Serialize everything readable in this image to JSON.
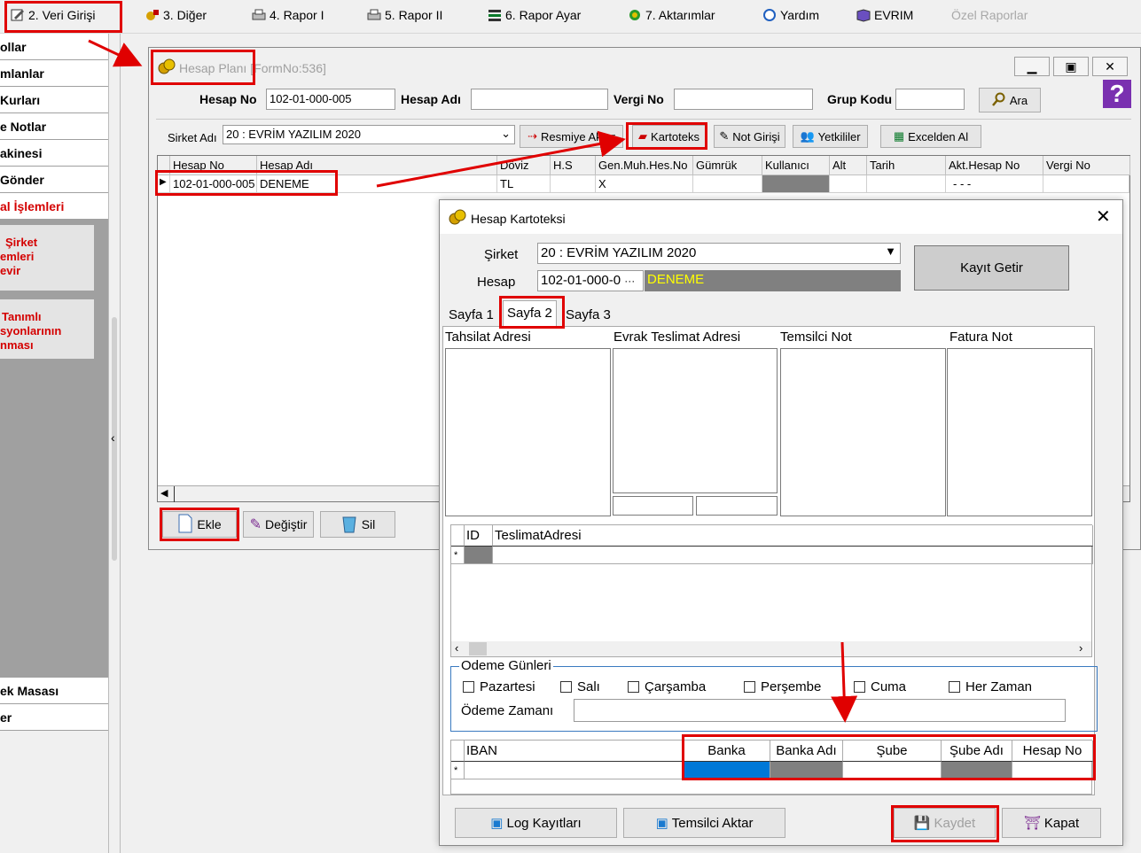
{
  "menu": [
    {
      "label": "2.  Veri Girişi",
      "icon": "edit-icon"
    },
    {
      "label": "3.  Diğer",
      "icon": "tools-icon"
    },
    {
      "label": "4.  Rapor I",
      "icon": "printer-icon"
    },
    {
      "label": "5.  Rapor II",
      "icon": "printer-icon"
    },
    {
      "label": "6.  Rapor Ayar",
      "icon": "report-settings-icon"
    },
    {
      "label": "7.  Aktarımlar",
      "icon": "transfer-icon"
    },
    {
      "label": "Yardım",
      "icon": "help-icon"
    },
    {
      "label": "EVRIM",
      "icon": "book-icon"
    },
    {
      "label": "Özel Raporlar",
      "icon": ""
    }
  ],
  "left_panel": {
    "items_top": [
      "ollar",
      "mlanlar",
      "Kurları",
      "e Notlar",
      "akinesi",
      "Gönder",
      "al İşlemleri"
    ],
    "tile1": [
      "Şirket",
      "emleri",
      "evir"
    ],
    "tile2": [
      "Tanımlı",
      "syonlarının",
      "nması"
    ],
    "items_bottom": [
      "ek Masası",
      "er"
    ]
  },
  "hesap_plani": {
    "title": "Hesap Planı",
    "form_no": "[FormNo:536]",
    "hesap_no_label": "Hesap No",
    "hesap_no_value": "102-01-000-005",
    "hesap_adi_label": "Hesap Adı",
    "vergi_no_label": "Vergi No",
    "grup_kodu_label": "Grup Kodu",
    "ara_label": "Ara",
    "sirket_label": "Sirket Adı",
    "sirket_value": "20 : EVRİM YAZILIM  2020",
    "toolbar": [
      "Resmiye Aktar",
      "Kartoteks",
      "Not Girişi",
      "Yetkililer",
      "Excelden Al"
    ],
    "columns": [
      "Hesap No",
      "Hesap Adı",
      "Döviz",
      "H.S",
      "Gen.Muh.Hes.No",
      "Gümrük",
      "Kullanıcı",
      "Alt",
      "Tarih",
      "Akt.Hesap No",
      "Vergi No"
    ],
    "row": [
      "102-01-000-005",
      "DENEME",
      "TL",
      "",
      "X",
      "",
      "",
      "",
      "",
      "- - -",
      ""
    ],
    "bottom_buttons": [
      "Ekle",
      "Değiştir",
      "Sil"
    ]
  },
  "kartoteks": {
    "title": "Hesap Kartoteksi",
    "sirket_label": "Şirket",
    "sirket_value": "20 : EVRİM YAZILIM  2020",
    "hesap_label": "Hesap",
    "hesap_no": "102-01-000-0",
    "hesap_adi": "DENEME",
    "kayit_getir": "Kayıt Getir",
    "tabs": [
      "Sayfa 1",
      "Sayfa 2",
      "Sayfa 3"
    ],
    "memo_headers": [
      "Tahsilat Adresi",
      "Evrak Teslimat Adresi",
      "Temsilci Not",
      "Fatura Not"
    ],
    "teslimat_columns": [
      "ID",
      "TeslimatAdresi"
    ],
    "odeme_gunleri_label": "Odeme Günleri",
    "days": [
      "Pazartesi",
      "Salı",
      "Çarşamba",
      "Perşembe",
      "Cuma",
      "Her Zaman"
    ],
    "odeme_zamani_label": "Ödeme Zamanı",
    "iban_columns": [
      "IBAN",
      "Banka",
      "Banka Adı",
      "Şube",
      "Şube Adı",
      "Hesap No"
    ],
    "buttons": [
      "Log Kayıtları",
      "Temsilci Aktar",
      "Kaydet",
      "Kapat"
    ]
  },
  "colors": {
    "highlight_red": "#e00000",
    "accent_blue": "#0078d7",
    "cell_gray": "#808080",
    "hesap_adi_text": "#ffff00"
  }
}
